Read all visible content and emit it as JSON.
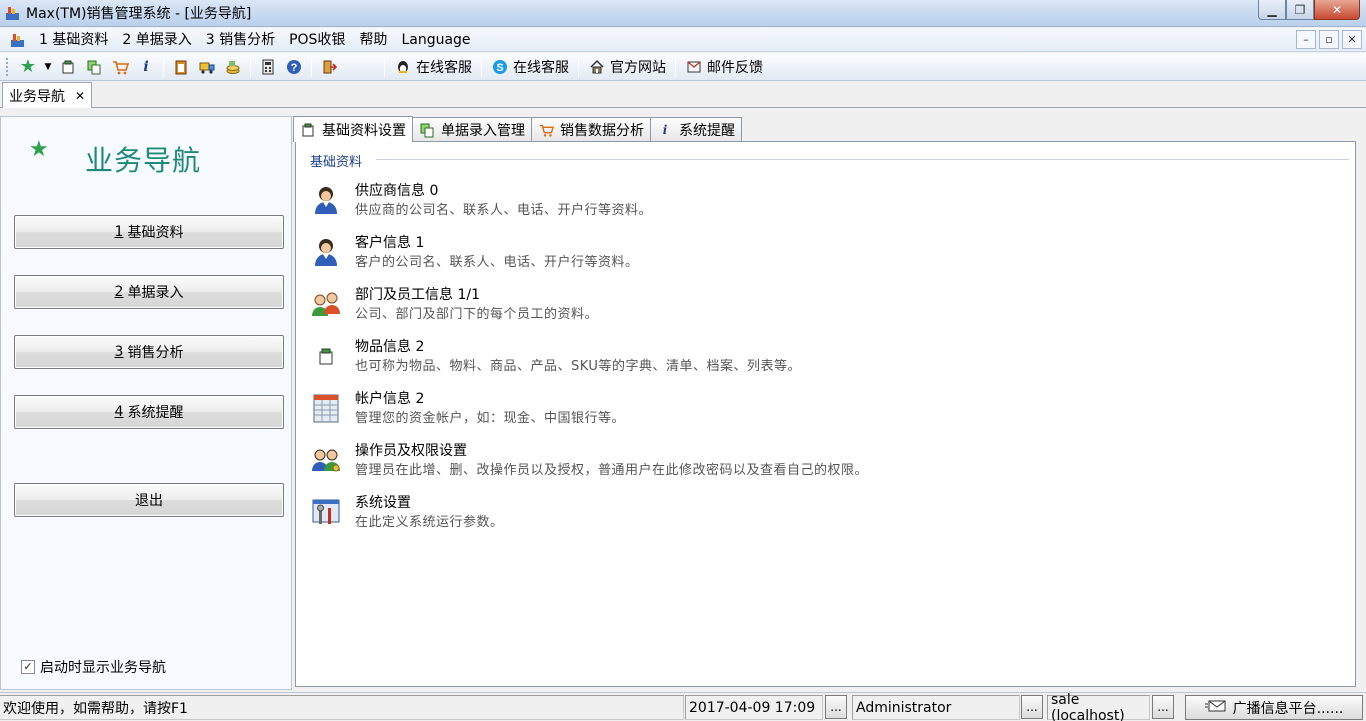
{
  "window": {
    "title": "Max(TM)销售管理系统 - [业务导航]",
    "minimize": "▁",
    "restore": "❐",
    "close": "✕"
  },
  "menubar": {
    "items": [
      "1 基础资料",
      "2 单据录入",
      "3 销售分析",
      "POS收银",
      "帮助",
      "Language"
    ],
    "mdi": [
      "–",
      "▫",
      "✕"
    ]
  },
  "toolbar": {
    "links": [
      "在线客服",
      "在线客服",
      "官方网站",
      "邮件反馈"
    ]
  },
  "doctab": {
    "label": "业务导航",
    "close": "✕"
  },
  "nav": {
    "title": "业务导航",
    "buttons": [
      {
        "key": "1",
        "label": "基础资料"
      },
      {
        "key": "2",
        "label": "单据录入"
      },
      {
        "key": "3",
        "label": "销售分析"
      },
      {
        "key": "4",
        "label": "系统提醒"
      }
    ],
    "exit": "退出",
    "startup_label": "启动时显示业务导航",
    "startup_checked": "✓"
  },
  "content": {
    "tabs": [
      "基础资料设置",
      "单据录入管理",
      "销售数据分析",
      "系统提醒"
    ],
    "group_title": "基础资料",
    "items": [
      {
        "name": "供应商信息 0",
        "desc": "供应商的公司名、联系人、电话、开户行等资料。"
      },
      {
        "name": "客户信息 1",
        "desc": "客户的公司名、联系人、电话、开户行等资料。"
      },
      {
        "name": "部门及员工信息 1/1",
        "desc": "公司、部门及部门下的每个员工的资料。"
      },
      {
        "name": "物品信息 2",
        "desc": "也可称为物品、物料、商品、产品、SKU等的字典、清单、档案、列表等。"
      },
      {
        "name": "帐户信息 2",
        "desc": "管理您的资金帐户，如：现金、中国银行等。"
      },
      {
        "name": "操作员及权限设置",
        "desc": "管理员在此增、删、改操作员以及授权，普通用户在此修改密码以及查看自己的权限。"
      },
      {
        "name": "系统设置",
        "desc": "在此定义系统运行参数。"
      }
    ]
  },
  "status": {
    "welcome": "欢迎使用，如需帮助，请按F1",
    "datetime": "2017-04-09 17:09",
    "user": "Administrator",
    "db": "sale (localhost)",
    "dots": "...",
    "broadcast": "广播信息平台......"
  }
}
